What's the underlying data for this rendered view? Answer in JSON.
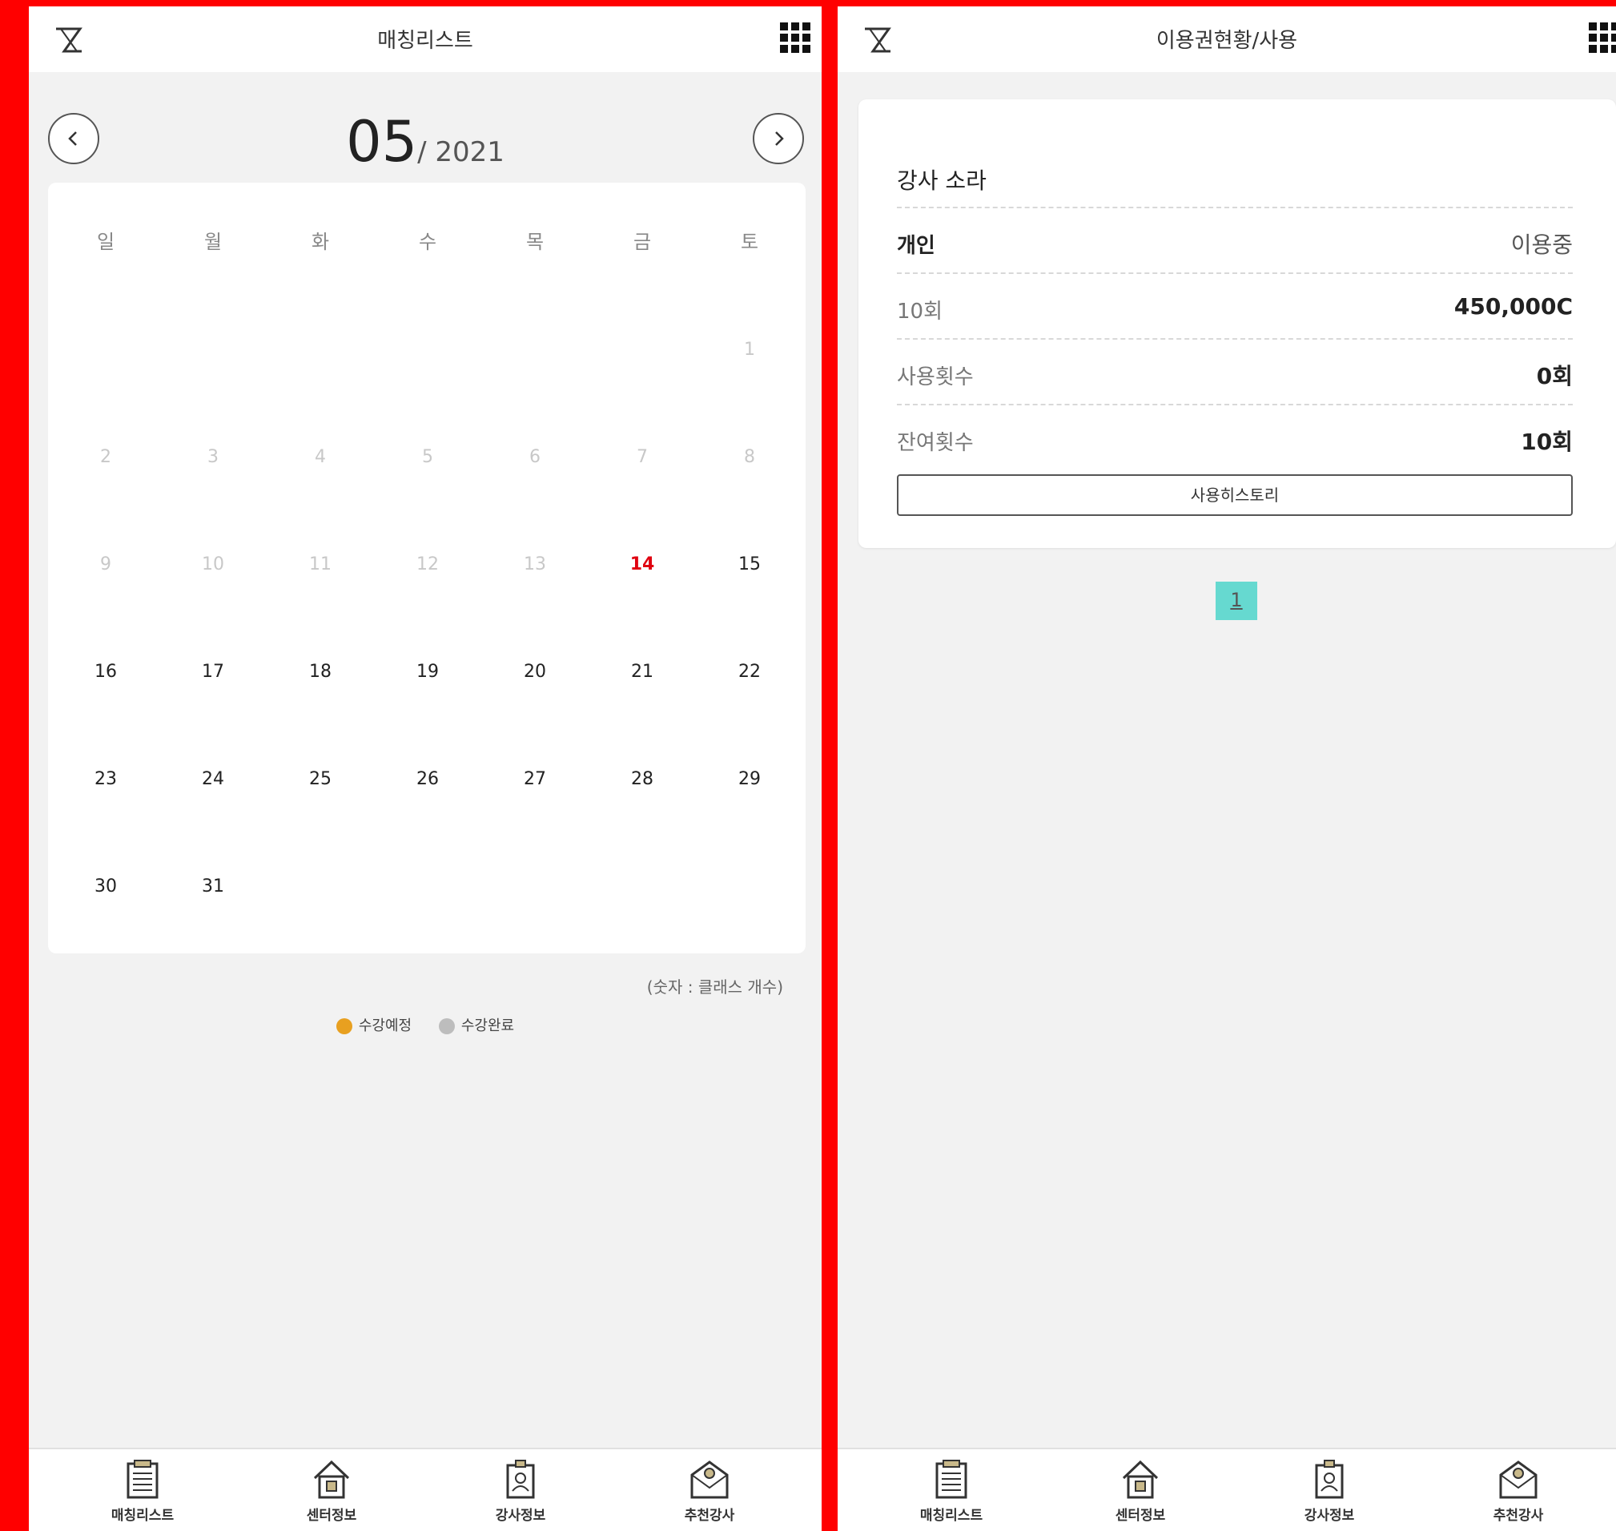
{
  "left": {
    "title": "매칭리스트",
    "month": "05",
    "year": "/ 2021",
    "weekdays": [
      "일",
      "월",
      "화",
      "수",
      "목",
      "금",
      "토"
    ],
    "weeks": [
      [
        "",
        "",
        "",
        "",
        "",
        "",
        "1"
      ],
      [
        "2",
        "3",
        "4",
        "5",
        "6",
        "7",
        "8"
      ],
      [
        "9",
        "10",
        "11",
        "12",
        "13",
        "14",
        "15"
      ],
      [
        "16",
        "17",
        "18",
        "19",
        "20",
        "21",
        "22"
      ],
      [
        "23",
        "24",
        "25",
        "26",
        "27",
        "28",
        "29"
      ],
      [
        "30",
        "31",
        "",
        "",
        "",
        "",
        ""
      ]
    ],
    "today": "14",
    "legend_note": "(숫자 : 클래스 개수)",
    "legend": [
      {
        "label": "수강예정",
        "color": "#e8a020"
      },
      {
        "label": "수강완료",
        "color": "#bdbdbd"
      }
    ]
  },
  "right": {
    "title": "이용권현황/사용",
    "card_title": "강사 소라",
    "rows": [
      {
        "label": "개인",
        "value": "이용중"
      },
      {
        "label": "10회",
        "value": "450,000C"
      },
      {
        "label": "사용횟수",
        "value": "0회"
      },
      {
        "label": "잔여횟수",
        "value": "10회"
      }
    ],
    "history_button": "사용히스토리",
    "page": "1"
  },
  "bottom_nav": [
    {
      "label": "매칭리스트",
      "icon": "clipboard-icon"
    },
    {
      "label": "센터정보",
      "icon": "house-icon"
    },
    {
      "label": "강사정보",
      "icon": "id-badge-icon"
    },
    {
      "label": "추천강사",
      "icon": "envelope-icon"
    }
  ]
}
